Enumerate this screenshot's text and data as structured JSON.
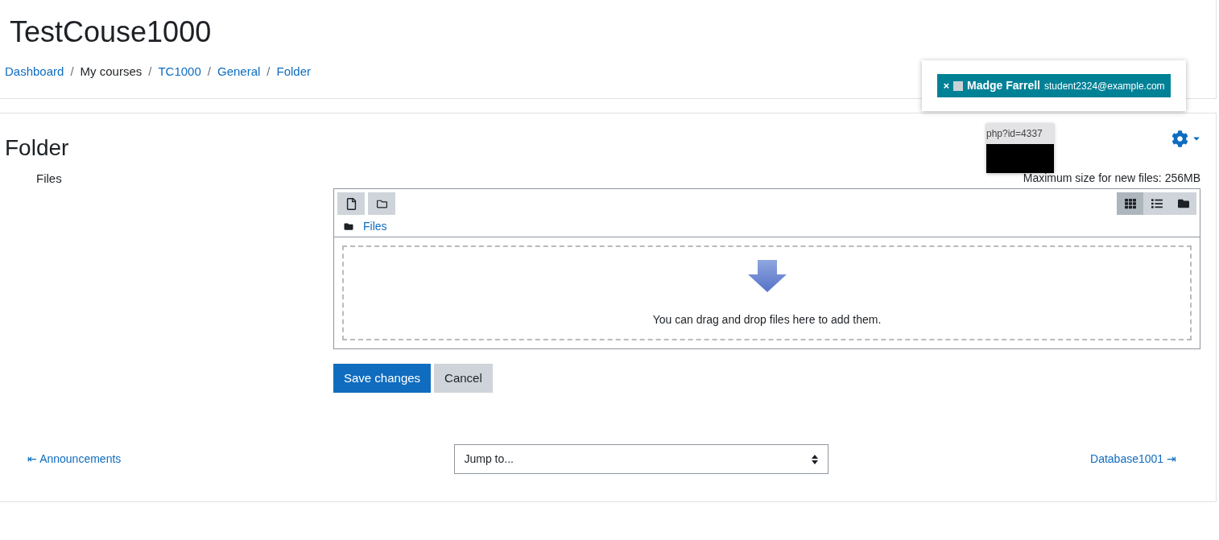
{
  "course_title": "TestCouse1000",
  "breadcrumb": [
    {
      "label": "Dashboard",
      "link": true
    },
    {
      "separator": "/",
      "label": "My courses",
      "link": false
    },
    {
      "separator": "/",
      "label": "TC1000",
      "link": true
    },
    {
      "separator": "/",
      "label": "General",
      "link": true
    },
    {
      "separator": "/",
      "label": "Folder",
      "link": true
    }
  ],
  "user_chip": {
    "remove": "×",
    "name": "Madge Farrell",
    "email": "student2324@example.com"
  },
  "tooltip": {
    "text": "php?id=4337"
  },
  "page_title": "Folder",
  "files_label": "Files",
  "max_size": "Maximum size for new files: 256MB",
  "view_modes": [
    {
      "kind": "grid",
      "selected": true
    },
    {
      "kind": "list",
      "selected": false
    },
    {
      "kind": "tree",
      "selected": false
    }
  ],
  "path": "Files",
  "drop_hint": "You can drag and drop files here to add them.",
  "buttons": {
    "save": "Save changes",
    "cancel": "Cancel"
  },
  "nav": {
    "prev_arrow": "⇤",
    "prev": "Announcements",
    "jump": "Jump to...",
    "next": "Database1001",
    "next_arrow": "⇥"
  }
}
